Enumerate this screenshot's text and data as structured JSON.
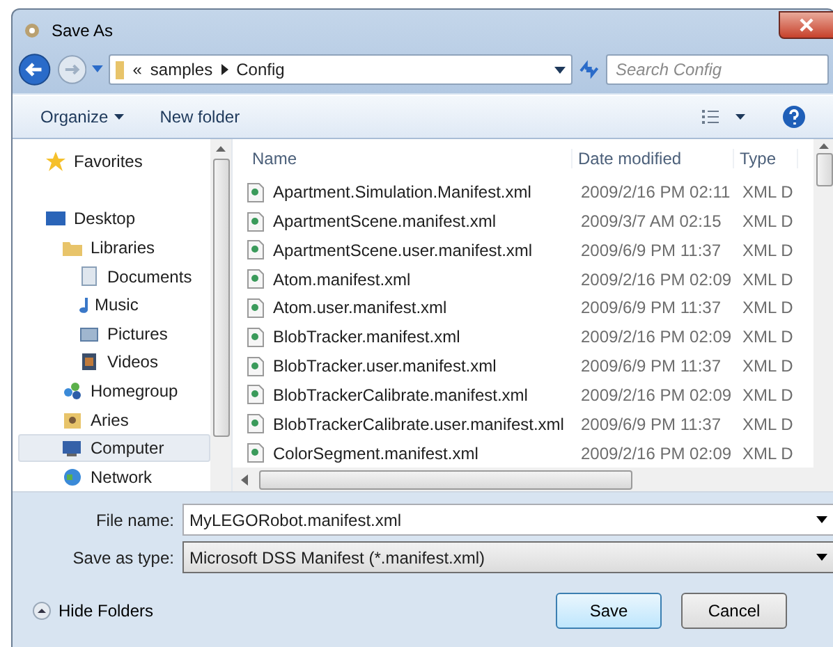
{
  "window": {
    "title": "Save As"
  },
  "address": {
    "overflow": "«",
    "crumbs": [
      "samples",
      "Config"
    ],
    "search_placeholder": "Search Config"
  },
  "toolbar": {
    "organize": "Organize",
    "new_folder": "New folder"
  },
  "sidebar": {
    "items": [
      {
        "label": "Favorites",
        "selected": false
      },
      {
        "label": "Desktop",
        "selected": false,
        "children": [
          {
            "label": "Libraries",
            "selected": false,
            "children": [
              {
                "label": "Documents",
                "selected": false
              },
              {
                "label": "Music",
                "selected": false
              },
              {
                "label": "Pictures",
                "selected": false
              },
              {
                "label": "Videos",
                "selected": false
              }
            ]
          },
          {
            "label": "Homegroup",
            "selected": false
          },
          {
            "label": "Aries",
            "selected": false
          },
          {
            "label": "Computer",
            "selected": true
          },
          {
            "label": "Network",
            "selected": false
          }
        ]
      }
    ]
  },
  "file_list": {
    "columns": [
      "Name",
      "Date modified",
      "Type"
    ],
    "rows": [
      {
        "name": "Apartment.Simulation.Manifest.xml",
        "date": "2009/2/16 PM 02:11",
        "type": "XML D"
      },
      {
        "name": "ApartmentScene.manifest.xml",
        "date": "2009/3/7 AM 02:15",
        "type": "XML D"
      },
      {
        "name": "ApartmentScene.user.manifest.xml",
        "date": "2009/6/9 PM 11:37",
        "type": "XML D"
      },
      {
        "name": "Atom.manifest.xml",
        "date": "2009/2/16 PM 02:09",
        "type": "XML D"
      },
      {
        "name": "Atom.user.manifest.xml",
        "date": "2009/6/9 PM 11:37",
        "type": "XML D"
      },
      {
        "name": "BlobTracker.manifest.xml",
        "date": "2009/2/16 PM 02:09",
        "type": "XML D"
      },
      {
        "name": "BlobTracker.user.manifest.xml",
        "date": "2009/6/9 PM 11:37",
        "type": "XML D"
      },
      {
        "name": "BlobTrackerCalibrate.manifest.xml",
        "date": "2009/2/16 PM 02:09",
        "type": "XML D"
      },
      {
        "name": "BlobTrackerCalibrate.user.manifest.xml",
        "date": "2009/6/9 PM 11:37",
        "type": "XML D"
      },
      {
        "name": "ColorSegment.manifest.xml",
        "date": "2009/2/16 PM 02:09",
        "type": "XML D"
      }
    ]
  },
  "form": {
    "file_name_label": "File name:",
    "file_name": "MyLEGORobot.manifest.xml",
    "type_label": "Save as type:",
    "type_value": "Microsoft DSS Manifest (*.manifest.xml)"
  },
  "footer": {
    "hide_folders": "Hide Folders",
    "buttons": [
      {
        "label": "Save",
        "default": true
      },
      {
        "label": "Cancel",
        "default": false
      }
    ]
  }
}
